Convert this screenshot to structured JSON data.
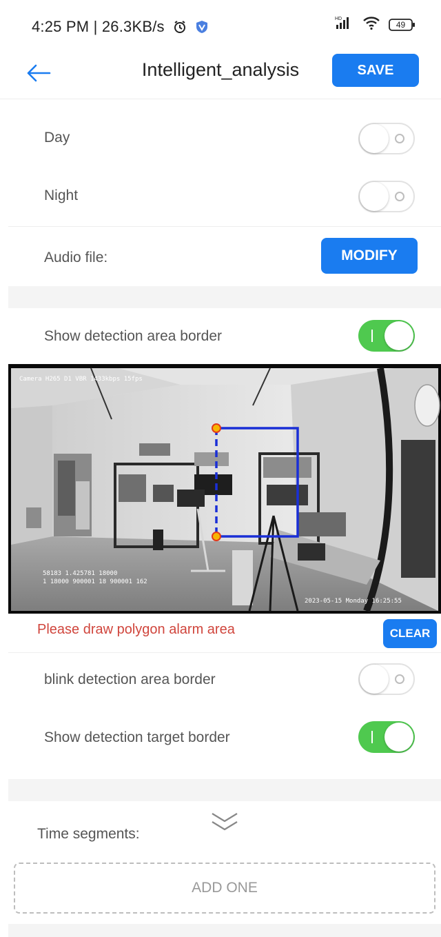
{
  "status_bar": {
    "time": "4:25 PM | 26.3KB/s",
    "battery": "49"
  },
  "header": {
    "title": "Intelligent_analysis",
    "save_label": "SAVE"
  },
  "schedule": {
    "day_label": "Day",
    "day_enabled": false,
    "night_label": "Night",
    "night_enabled": false
  },
  "audio": {
    "label": "Audio file:",
    "modify_label": "MODIFY"
  },
  "show_area_border": {
    "label": "Show detection area border",
    "enabled": true
  },
  "camera": {
    "osd_top": "Camera H265 D1 VBR 1433kbps 15fps",
    "osd_stats_1": "58183 1.425781 18000",
    "osd_stats_2": "1 18000 900001 18 900001 162",
    "osd_timestamp": "2023-05-15 Monday 16:25:55",
    "polygon_color": "#1a2fd6",
    "vertex_color": "#f7b500"
  },
  "area_hint": {
    "text": "Please draw polygon alarm area",
    "clear_label": "CLEAR"
  },
  "blink_area_border": {
    "label": "blink detection area border",
    "enabled": false
  },
  "show_target_border": {
    "label": "Show detection target border",
    "enabled": true
  },
  "time_segments": {
    "label": "Time segments:",
    "expand_icon": "double-chevron-down-icon",
    "add_label": "ADD ONE"
  },
  "colors": {
    "accent": "#1a7cf0",
    "toggle_on": "#4fc94f",
    "warning": "#d0453c"
  }
}
